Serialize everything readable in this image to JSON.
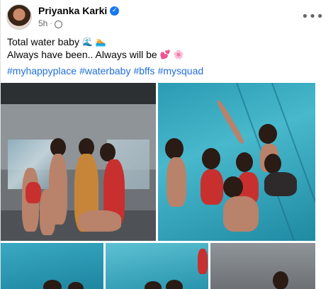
{
  "post": {
    "author": "Priyanka Karki",
    "verified_icon": "verified-badge-icon",
    "time": "5h",
    "privacy_icon": "globe-icon",
    "more_label": "•••",
    "text_line1": "Total water baby",
    "text_line1_emojis": [
      "wave-emoji",
      "swimmer-emoji"
    ],
    "text_line2": "Always have been.. Always will be",
    "text_line2_emojis": [
      "hearts-emoji",
      "flower-emoji"
    ],
    "hashtags": [
      "#myhappyplace",
      "#waterbaby",
      "#bffs",
      "#mysquad"
    ]
  },
  "photos": [
    {
      "name": "group-photo-poolside"
    },
    {
      "name": "group-photo-in-pool"
    },
    {
      "name": "pool-photo-3"
    },
    {
      "name": "pool-photo-4"
    },
    {
      "name": "poolside-photo-5"
    }
  ],
  "colors": {
    "link": "#216fdb",
    "verified": "#1877f2",
    "meta": "#65676b"
  }
}
